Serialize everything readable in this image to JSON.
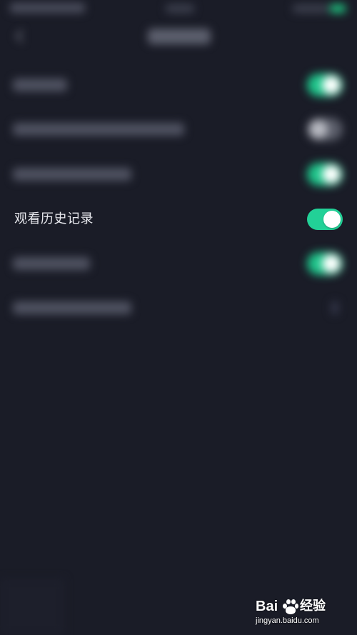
{
  "status_bar": {
    "battery_color": "#1fbf7e"
  },
  "navbar": {
    "back_icon": "back-arrow-icon"
  },
  "settings": {
    "focused_row": {
      "label": "观看历史记录",
      "toggle_on": true,
      "toggle_color": "#22d197"
    },
    "blurred_rows": [
      {
        "toggle": "on"
      },
      {
        "toggle": "off"
      },
      {
        "toggle": "on"
      },
      {
        "toggle": "on"
      },
      {
        "toggle": "chevron"
      }
    ]
  },
  "watermark": {
    "brand_prefix": "Bai",
    "brand_suffix": "经验",
    "url": "jingyan.baidu.com",
    "paw_icon": "baidu-paw-icon"
  },
  "colors": {
    "background": "#1a1c27",
    "accent": "#1ec48a",
    "text_primary": "#e9eaef"
  }
}
